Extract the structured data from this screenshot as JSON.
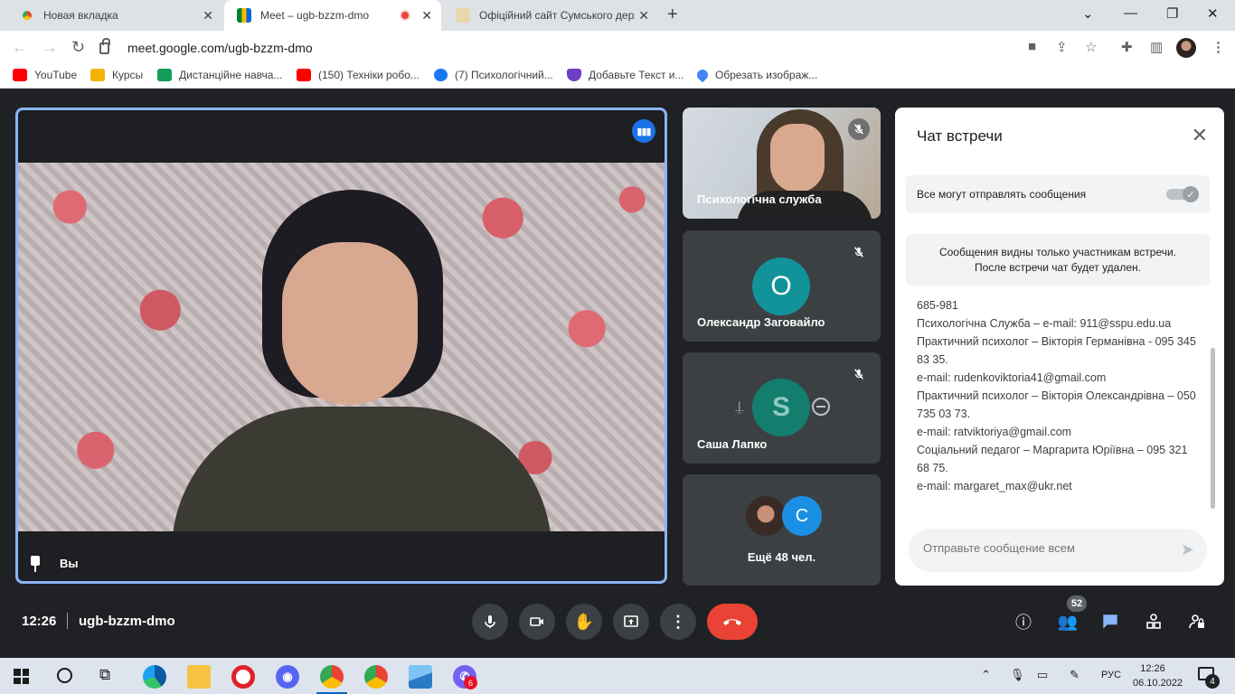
{
  "browser": {
    "tabs": [
      {
        "title": "Новая вкладка"
      },
      {
        "title": "Meet – ugb-bzzm-dmo"
      },
      {
        "title": "Офіційний сайт Сумського держ"
      }
    ],
    "url": "meet.google.com/ugb-bzzm-dmo",
    "bookmarks": [
      {
        "label": "YouTube",
        "color": "#ff0000"
      },
      {
        "label": "Курсы",
        "color": "#f4b400"
      },
      {
        "label": "Дистанційне навча...",
        "color": "#0f9d58"
      },
      {
        "label": "(150) Техніки робо...",
        "color": "#ff0000"
      },
      {
        "label": "(7) Психологічний...",
        "color": "#1877f2"
      },
      {
        "label": "Добавьте Текст и...",
        "color": "#6c3fc5"
      },
      {
        "label": "Обрезать изображ...",
        "color": "#4285f4"
      }
    ]
  },
  "meet": {
    "main_tile": {
      "name": "Вы"
    },
    "side_tiles": [
      {
        "name": "Психологічна служба"
      },
      {
        "name": "Олександр Заговайло",
        "initial": "О",
        "avatar_color": "#12939a"
      },
      {
        "name": "Саша Лапко",
        "initial": "S",
        "avatar_color": "#137d6e"
      },
      {
        "name": "Ещё 48 чел.",
        "initial": "С",
        "avatar_color": "#1a8fe3"
      }
    ],
    "chat": {
      "title": "Чат встречи",
      "toggle_label": "Все могут отправлять сообщения",
      "notice_line1": "Сообщения видны только участникам встречи.",
      "notice_line2": "После встречи чат будет удален.",
      "messages": [
        "685-981",
        "Психологічна Служба – e-mail: 911@sspu.edu.ua",
        "Практичний психолог – Вікторія Германівна - 095 345 83 35.",
        "e-mail: rudenkoviktoria41@gmail.com",
        "Практичний психолог – Вікторія Олександрівна – 050 735 03 73.",
        "e-mail: ratviktoriya@gmail.com",
        "Соціальний педагог – Маргарита Юріївна – 095 321 68 75.",
        "e-mail: margaret_max@ukr.net"
      ],
      "input_placeholder": "Отправьте сообщение всем"
    },
    "bottom": {
      "time": "12:26",
      "meeting_code": "ugb-bzzm-dmo",
      "participants_count": "52"
    }
  },
  "taskbar": {
    "language": "РУС",
    "time": "12:26",
    "date": "06.10.2022",
    "notifications": "4",
    "viber_badge": "6"
  },
  "colors": {
    "accent": "#8ab4f8",
    "end_call": "#ea4335",
    "background": "#202124"
  }
}
